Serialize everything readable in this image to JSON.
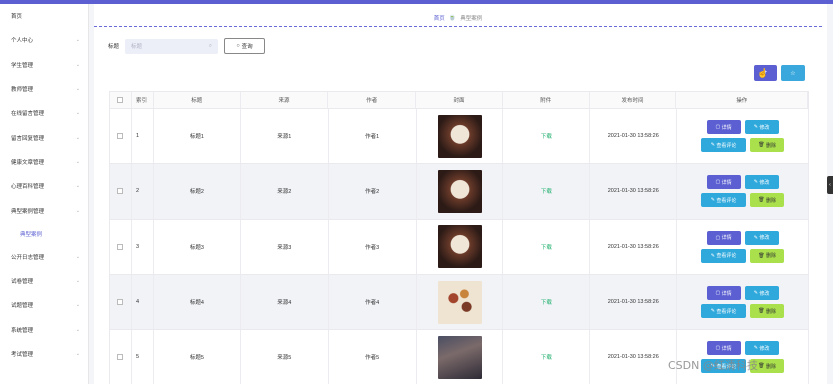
{
  "sidebar": {
    "items": [
      {
        "label": "首页",
        "chev": ""
      },
      {
        "label": "个人中心",
        "chev": "⌄"
      },
      {
        "label": "学生管理",
        "chev": "⌄"
      },
      {
        "label": "教师管理",
        "chev": "⌄"
      },
      {
        "label": "在线留言管理",
        "chev": "⌄"
      },
      {
        "label": "留言回复管理",
        "chev": "⌄"
      },
      {
        "label": "健康文章管理",
        "chev": "⌄"
      },
      {
        "label": "心理百科管理",
        "chev": "⌄"
      },
      {
        "label": "典型案例管理",
        "chev": "⌄"
      },
      {
        "label": "典型案例",
        "chev": ""
      },
      {
        "label": "公开日志管理",
        "chev": "⌄"
      },
      {
        "label": "试卷管理",
        "chev": "⌄"
      },
      {
        "label": "试题管理",
        "chev": "⌄"
      },
      {
        "label": "系统管理",
        "chev": "⌄"
      },
      {
        "label": "考试管理",
        "chev": "⌄"
      }
    ]
  },
  "breadcrumb": {
    "home": "首页",
    "sep_icon": "🍵",
    "current": "典型案例"
  },
  "search": {
    "label": "标题",
    "placeholder": "标题",
    "button": "查询"
  },
  "actions": {
    "add_label": "+",
    "delete_label": "☆"
  },
  "table": {
    "headers": [
      "",
      "索引",
      "标题",
      "来源",
      "作者",
      "封面",
      "附件",
      "发布时间",
      "操作"
    ],
    "rows": [
      {
        "index": "1",
        "title": "标题1",
        "source": "来源1",
        "author": "作者1",
        "file": "下载",
        "time": "2021-01-30 13:58:26"
      },
      {
        "index": "2",
        "title": "标题2",
        "source": "来源2",
        "author": "作者2",
        "file": "下载",
        "time": "2021-01-30 13:58:26"
      },
      {
        "index": "3",
        "title": "标题3",
        "source": "来源3",
        "author": "作者3",
        "file": "下载",
        "time": "2021-01-30 13:58:26"
      },
      {
        "index": "4",
        "title": "标题4",
        "source": "来源4",
        "author": "作者4",
        "file": "下载",
        "time": "2021-01-30 13:58:26"
      },
      {
        "index": "5",
        "title": "标题5",
        "source": "来源5",
        "author": "作者5",
        "file": "下载",
        "time": "2021-01-30 13:58:26"
      }
    ],
    "ops": {
      "detail": "详情",
      "edit": "修改",
      "comment": "查看评论",
      "delete": "删除"
    }
  },
  "watermark": "CSDN @红清科技",
  "colors": {
    "accent": "#5b5fd1",
    "info": "#2fa8dc",
    "success": "#21b06e",
    "lime": "#a9e04c"
  }
}
